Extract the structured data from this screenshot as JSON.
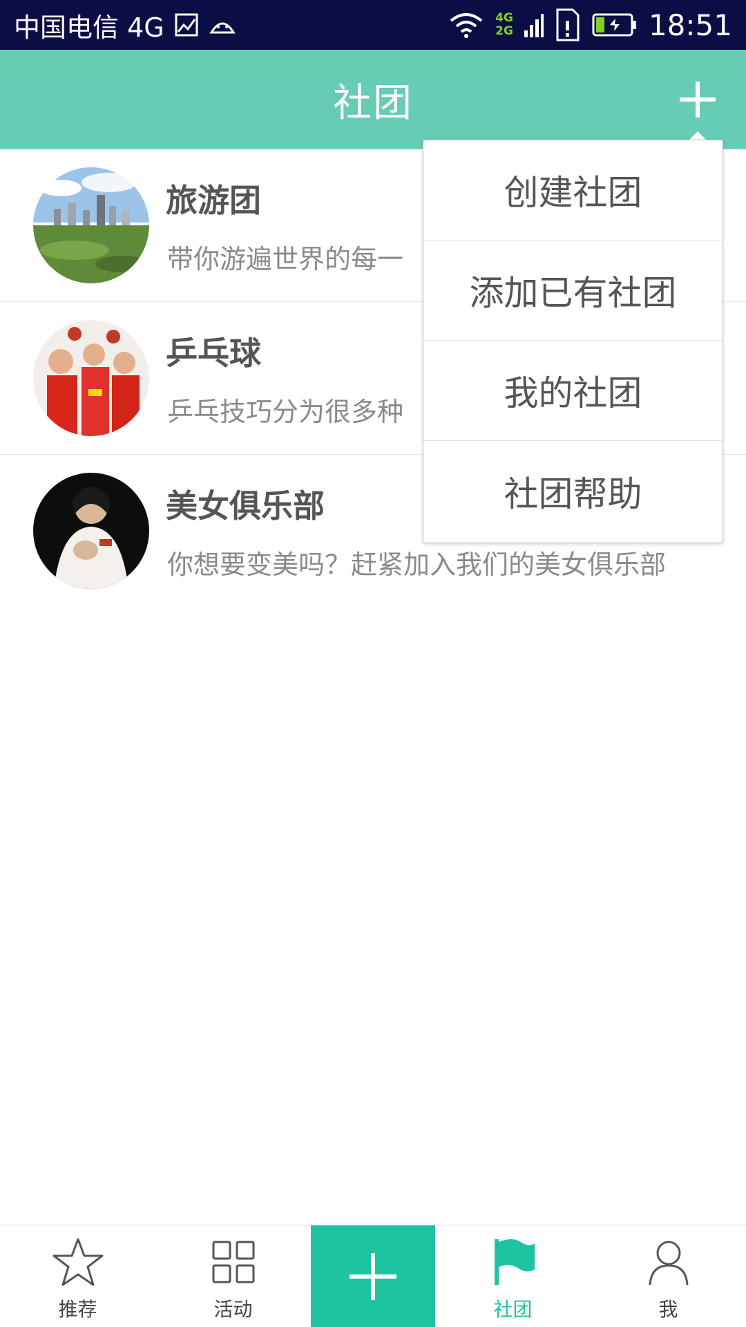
{
  "status_bar": {
    "carrier": "中国电信 4G",
    "network_top": "4G",
    "network_bottom": "2G",
    "time": "18:51"
  },
  "header": {
    "title": "社团",
    "add_icon": "plus-icon"
  },
  "clubs": [
    {
      "name": "旅游团",
      "description": " 带你游遍世界的每一",
      "avatar": "city-photo"
    },
    {
      "name": "乒乓球",
      "description": "乒乓技巧分为很多种",
      "avatar": "pingpong-team-photo"
    },
    {
      "name": "美女俱乐部",
      "description": "你想要变美吗？赶紧加入我们的美女俱乐部",
      "avatar": "woman-photo"
    }
  ],
  "menu": {
    "items": [
      "创建社团",
      "添加已有社团",
      "我的社团",
      "社团帮助"
    ]
  },
  "bottom_nav": {
    "items": [
      {
        "label": "推荐",
        "icon": "star-icon"
      },
      {
        "label": "活动",
        "icon": "grid-icon"
      },
      {
        "label": "",
        "icon": "plus-icon"
      },
      {
        "label": "社团",
        "icon": "flag-icon"
      },
      {
        "label": "我",
        "icon": "person-icon"
      }
    ],
    "active": "社团"
  },
  "colors": {
    "status_bar": "#0b0d45",
    "header": "#66ccb4",
    "accent": "#1ec4a1"
  }
}
